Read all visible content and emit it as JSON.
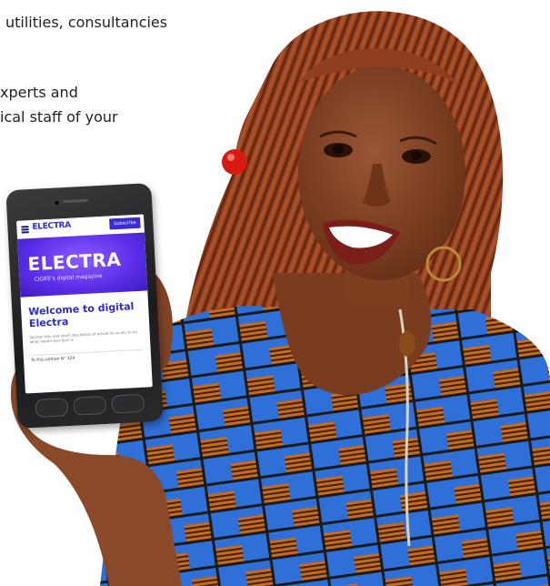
{
  "background_text": {
    "line1": "utilities, consultancies",
    "line2": "xperts and",
    "line3": "ical staff of your"
  },
  "phone_screen": {
    "logo": "ELECTRA",
    "subscribe_label": "Subscribe",
    "hero_title": "ELECTRA",
    "hero_subtitle": "CIGRE's digital magazine",
    "welcome_heading": "Welcome to digital Electra",
    "description": "Section title and short description of article no so etc so on what means just tech is",
    "edition_note": "To this edition N° 324"
  },
  "colors": {
    "electra_purple": "#5b2de8",
    "electra_blue": "#2b2bd6",
    "dress_blue": "#2e6fd6",
    "dress_orange": "#c9681a",
    "skin": "#8a4b2a",
    "hair": "#8f3f1d"
  }
}
